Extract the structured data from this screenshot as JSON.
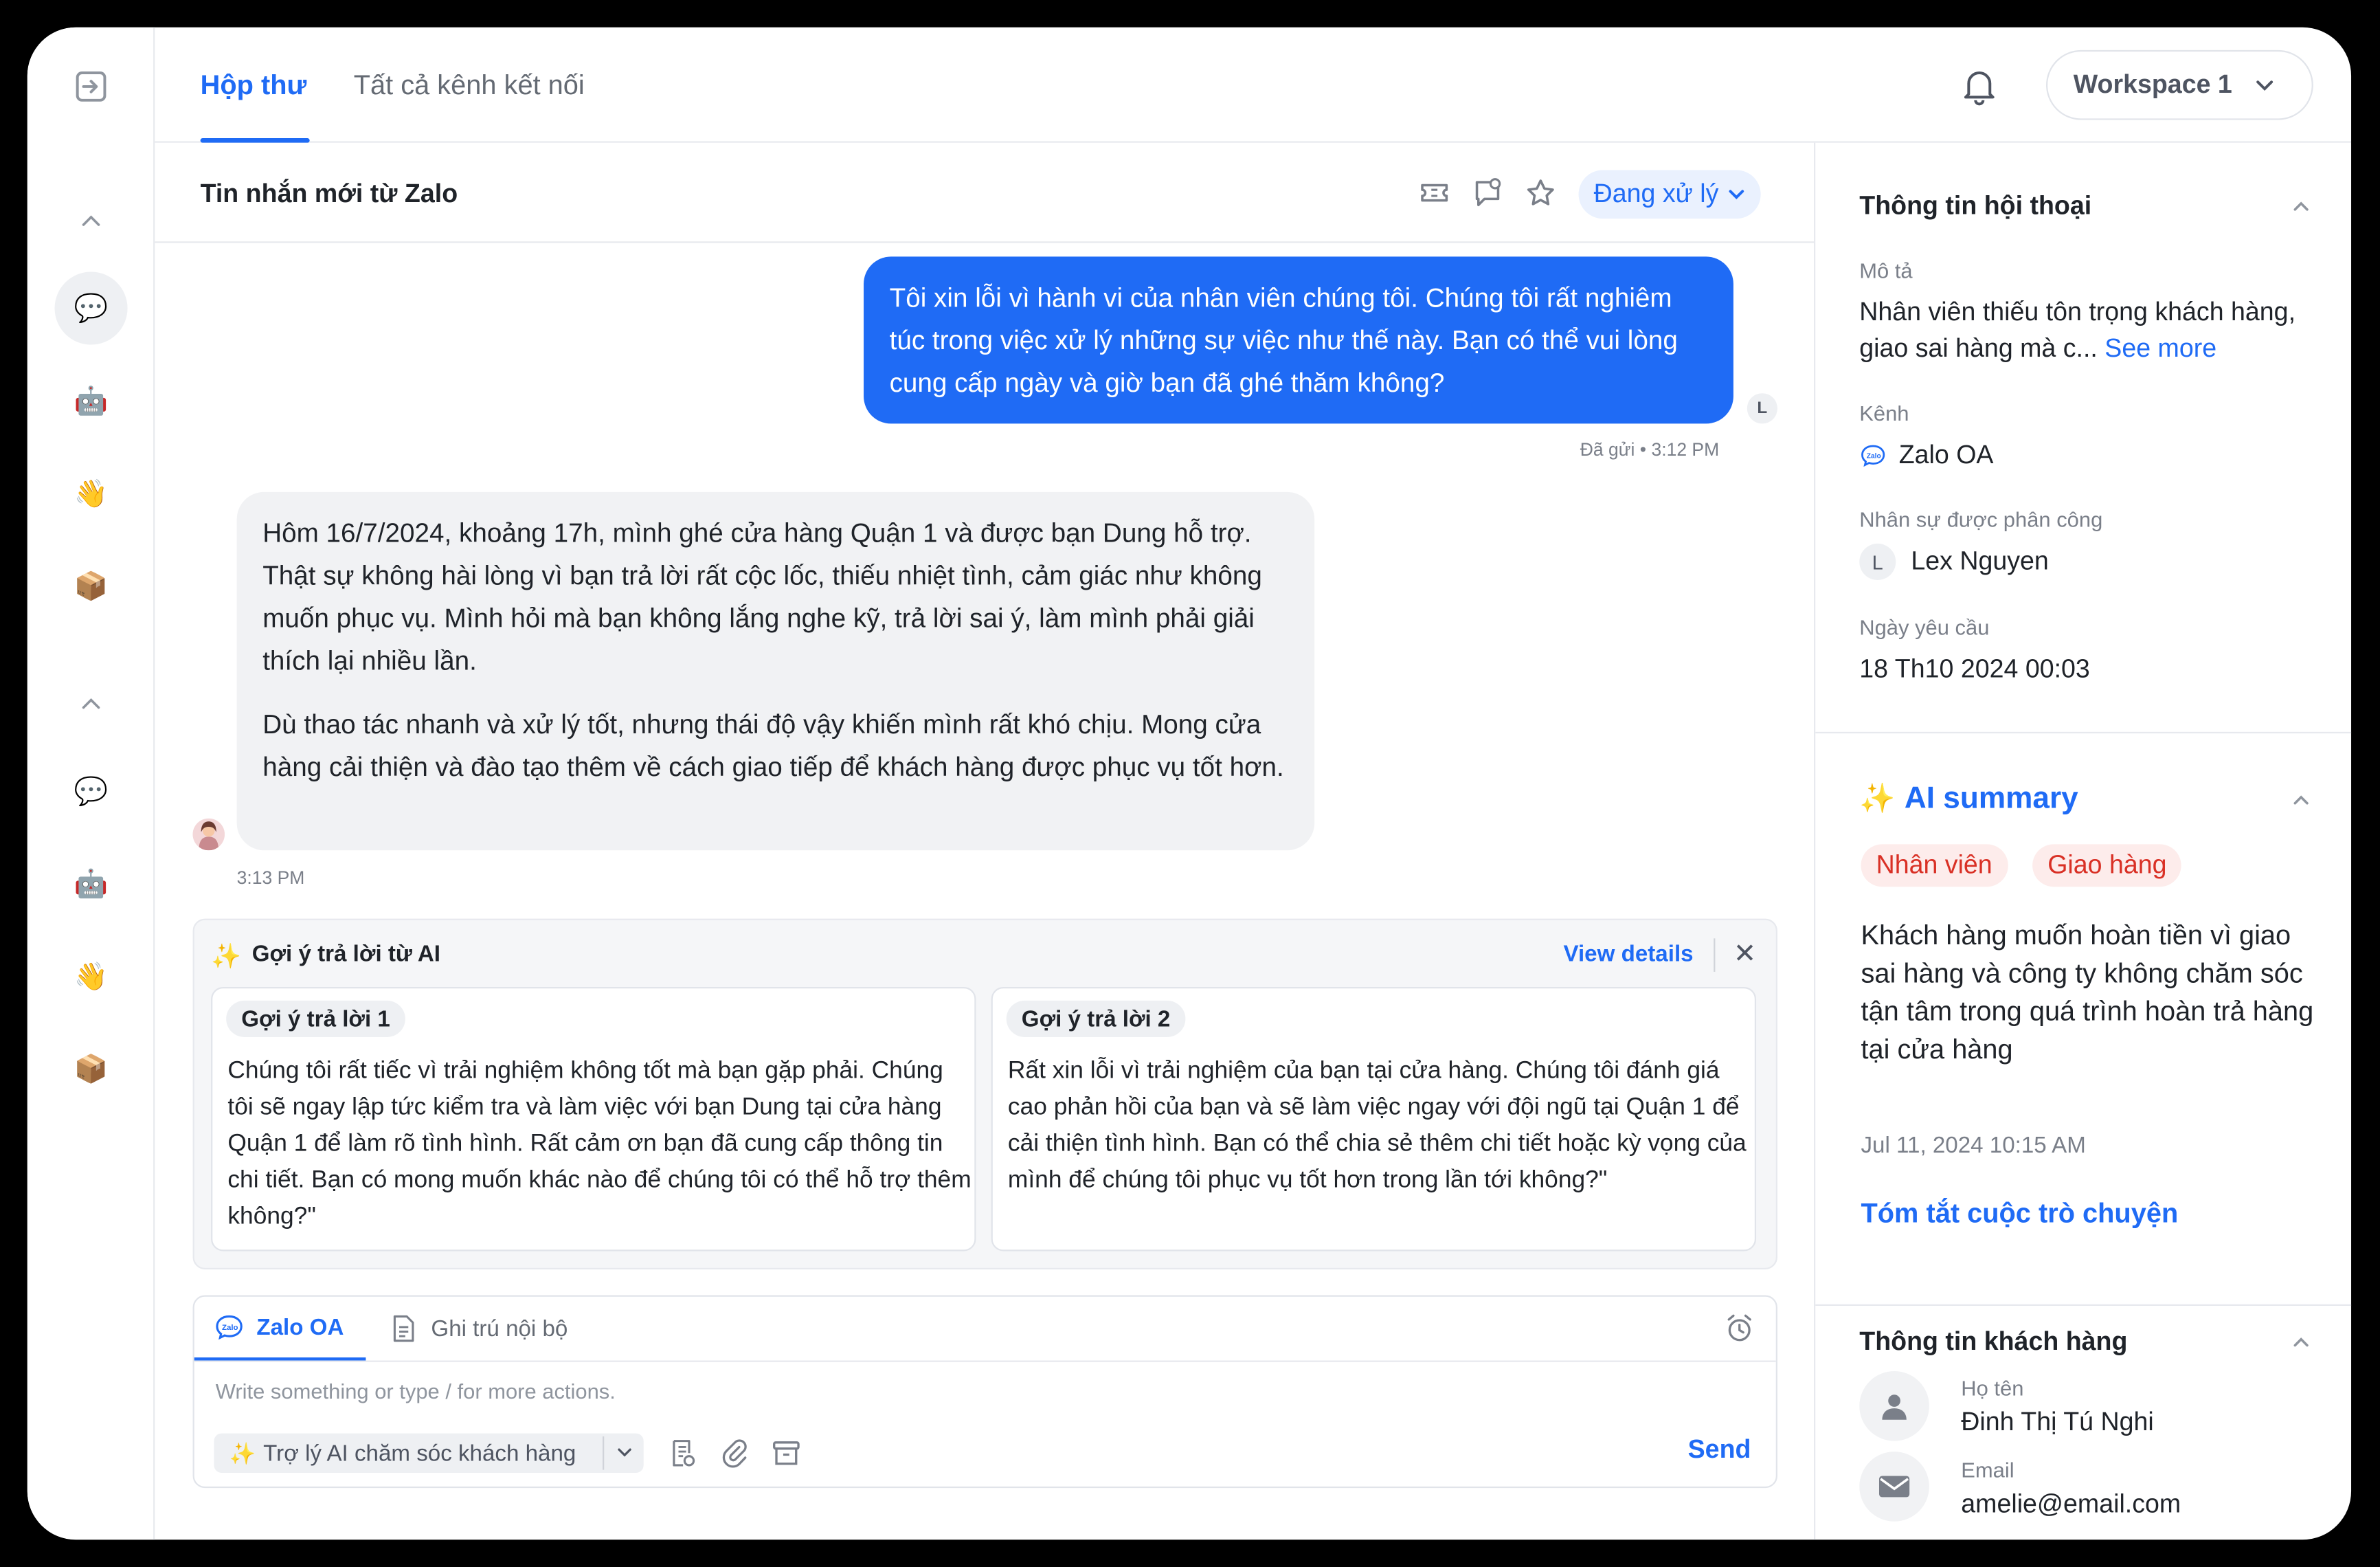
{
  "topbar": {
    "tabs": [
      {
        "label": "Hộp thư"
      },
      {
        "label": "Tất cả kênh kết nối"
      }
    ],
    "workspace": "Workspace 1"
  },
  "rail": {
    "group1": [
      "chat-icon",
      "robot-icon",
      "wave-icon",
      "package-icon"
    ],
    "group2": [
      "chat-icon",
      "robot-icon",
      "wave-icon",
      "package-icon"
    ]
  },
  "conversation": {
    "title": "Tin nhắn mới từ Zalo",
    "status": "Đang xử lý",
    "outgoing": {
      "text": "Tôi xin lỗi vì hành vi của nhân viên chúng tôi. Chúng tôi rất nghiêm túc trong việc xử lý những sự việc như thế này. Bạn có thể vui lòng cung cấp ngày và giờ bạn đã ghé thăm không?",
      "avatar_initial": "L",
      "status_text": "Đã gửi",
      "time": "3:12 PM"
    },
    "incoming": {
      "para1": "Hôm 16/7/2024, khoảng 17h, mình ghé cửa hàng Quận 1 và được bạn Dung hỗ trợ. Thật sự không hài lòng vì bạn trả lời rất cộc lốc, thiếu nhiệt tình, cảm giác như không muốn phục vụ. Mình hỏi mà bạn không lắng nghe kỹ, trả lời sai ý, làm mình phải giải thích lại nhiều lần.",
      "para2": "Dù thao tác nhanh và xử lý tốt, nhưng thái độ vậy khiến mình rất khó chịu. Mong cửa hàng cải thiện và đào tạo thêm về cách giao tiếp để khách hàng được phục vụ tốt hơn.",
      "time": "3:13 PM"
    }
  },
  "ai_suggest": {
    "title": "Gợi ý trả lời từ AI",
    "view_details": "View details",
    "suggestions": [
      {
        "tag": "Gợi ý trả lời 1",
        "text": "Chúng tôi rất tiếc vì trải nghiệm không tốt mà bạn gặp phải. Chúng tôi sẽ ngay lập tức kiểm tra và làm việc với bạn Dung tại cửa hàng Quận 1 để làm rõ tình hình. Rất cảm ơn bạn đã cung cấp thông tin chi tiết. Bạn có mong muốn khác nào để chúng tôi có thể hỗ trợ thêm không?\""
      },
      {
        "tag": "Gợi ý trả lời 2",
        "text": "Rất xin lỗi vì trải nghiệm của bạn tại cửa hàng. Chúng tôi đánh giá cao phản hồi của bạn và sẽ làm việc ngay với đội ngũ tại Quận 1 để cải thiện tình hình. Bạn có thể chia sẻ thêm chi tiết hoặc kỳ vọng của mình để chúng tôi phục vụ tốt hơn trong lần tới không?\""
      }
    ]
  },
  "composer": {
    "tab_zalo": "Zalo OA",
    "tab_note": "Ghi trú nội bộ",
    "placeholder": "Write something or type / for more actions.",
    "ai_assistant": "Trợ lý AI chăm sóc khách hàng",
    "send": "Send"
  },
  "right_panel": {
    "conv_info": {
      "title": "Thông tin hội thoại",
      "desc_label": "Mô tả",
      "desc_value": "Nhân viên thiếu tôn trọng khách hàng, giao sai hàng mà c...",
      "see_more": "See more",
      "channel_label": "Kênh",
      "channel_value": "Zalo OA",
      "assignee_label": "Nhân sự được phân công",
      "assignee_initial": "L",
      "assignee_value": "Lex Nguyen",
      "date_label": "Ngày yêu cầu",
      "date_value": "18 Th10 2024 00:03"
    },
    "ai_summary": {
      "title": "AI summary",
      "tags": [
        "Nhân viên",
        "Giao hàng"
      ],
      "text": "Khách hàng muốn hoàn tiền vì giao sai hàng và công ty không chăm sóc tận tâm trong quá trình hoàn trả hàng tại cửa hàng",
      "date": "Jul 11, 2024 10:15 AM",
      "link": "Tóm tắt cuộc trò chuyện"
    },
    "customer": {
      "title": "Thông tin khách hàng",
      "name_label": "Họ tên",
      "name_value": "Đinh Thị Tú Nghi",
      "email_label": "Email",
      "email_value": "amelie@email.com"
    }
  },
  "colors": {
    "accent": "#1f6bf5",
    "tag_red": "#d93025",
    "bubble_in": "#f1f2f4"
  }
}
